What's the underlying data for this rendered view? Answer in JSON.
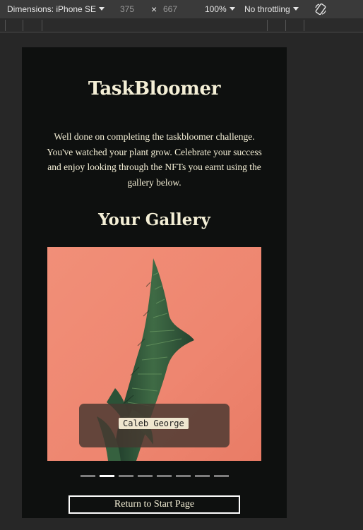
{
  "devtools": {
    "device_label": "Dimensions: iPhone SE",
    "width_value": "375",
    "times_symbol": "×",
    "height_value": "667",
    "zoom_label": "100%",
    "throttle_label": "No throttling"
  },
  "app": {
    "title": "TaskBloomer",
    "intro": "Well done on completing the taskbloomer challenge. You've watched your plant grow. Celebrate your success and enjoy looking through the NFTs you earnt using the gallery below.",
    "gallery_title": "Your Gallery",
    "caption": "Caleb George",
    "slide_count": 8,
    "active_slide": 2,
    "return_label": "Return to Start Page"
  },
  "colors": {
    "page_background": "#0e100f",
    "text_cream": "#f4efd6",
    "image_background": "#ef8a72",
    "indicator_inactive": "#7d7d7d",
    "indicator_active": "#ffffff"
  }
}
